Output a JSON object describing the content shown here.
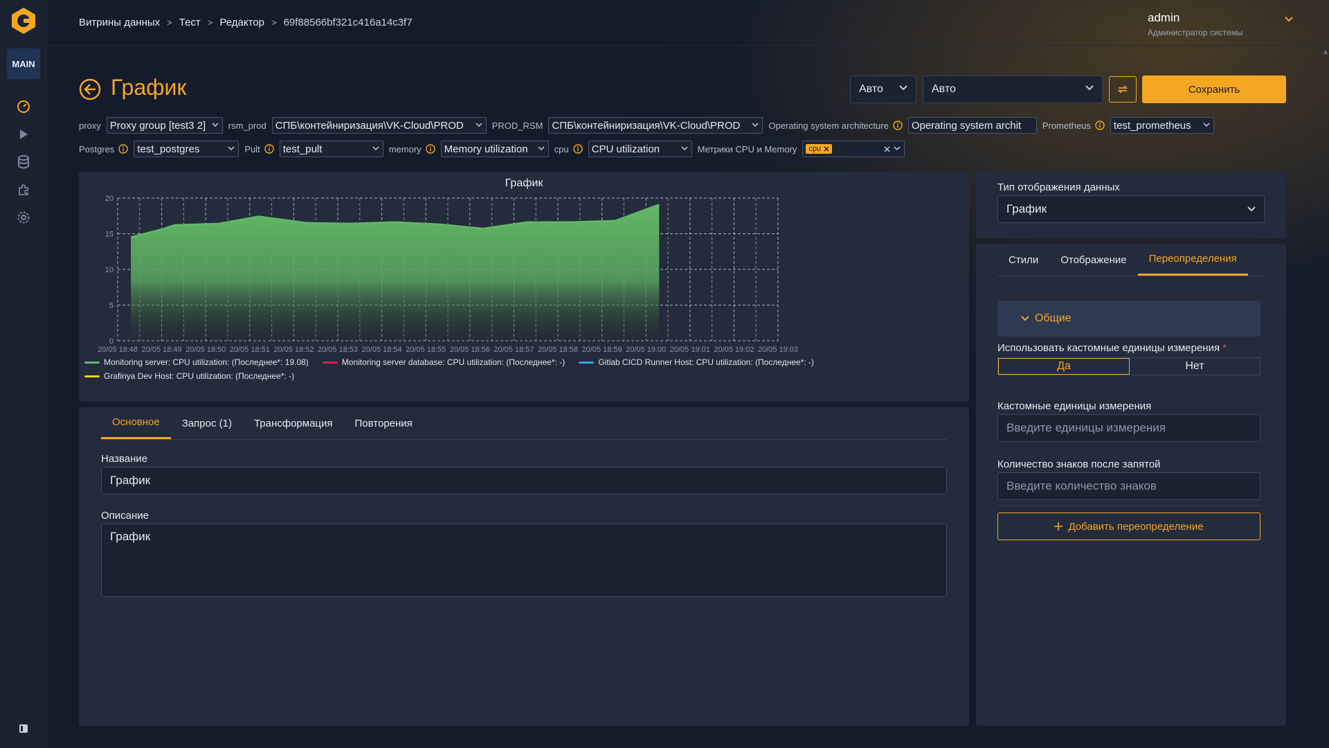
{
  "sidebar": {
    "main_label": "MAIN",
    "icons": [
      "dashboard-icon",
      "play-icon",
      "database-icon",
      "puzzle-icon",
      "gear-icon"
    ]
  },
  "breadcrumb": [
    "Витрины данных",
    "Тест",
    "Редактор",
    "69f88566bf321c416a14c3f7"
  ],
  "user": {
    "name": "admin",
    "role": "Администратор системы"
  },
  "header": {
    "title": "График",
    "select_small": "Авто",
    "select_large": "Авто",
    "save_label": "Сохранить"
  },
  "variables": {
    "row1": [
      {
        "label": "proxy",
        "value": "Proxy group [test3 2]",
        "info": false
      },
      {
        "label": "rsm_prod",
        "value": "СПБ\\контейниризация\\VK-Cloud\\PROD",
        "info": false
      },
      {
        "label": "PROD_RSM",
        "value": "СПБ\\контейниризация\\VK-Cloud\\PROD",
        "info": false
      },
      {
        "label": "Operating system architecture",
        "value": "Operating system archit",
        "info": true
      },
      {
        "label": "Prometheus",
        "value": "test_prometheus",
        "info": true
      }
    ],
    "row2": [
      {
        "label": "Postgres",
        "value": "test_postgres",
        "info": true
      },
      {
        "label": "Pult",
        "value": "test_pult",
        "info": true
      },
      {
        "label": "memory",
        "value": "Memory utilization",
        "info": true
      },
      {
        "label": "cpu",
        "value": "CPU utilization",
        "info": true
      }
    ],
    "metrics_label": "Метрики CPU и Memory",
    "metrics_chip": "cpu"
  },
  "chart_data": {
    "type": "area",
    "title": "График",
    "x": [
      "20/05 18:48",
      "20/05 18:49",
      "20/05 18:50",
      "20/05 18:51",
      "20/05 18:52",
      "20/05 18:53",
      "20/05 18:54",
      "20/05 18:55",
      "20/05 18:56",
      "20/05 18:57",
      "20/05 18:58",
      "20/05 18:59",
      "20/05 19:00",
      "20/05 19:01",
      "20/05 19:02",
      "20/05 19:03"
    ],
    "yticks": [
      0,
      5,
      10,
      15,
      20
    ],
    "ylim": [
      0,
      20
    ],
    "grid": true,
    "series": [
      {
        "name": "Monitoring server: CPU utilization: (Последнее*: 19.08)",
        "color": "#5fb865",
        "points": [
          {
            "t": 0.3,
            "v": 14.5
          },
          {
            "t": 1.0,
            "v": 15.6
          },
          {
            "t": 1.3,
            "v": 16.2
          },
          {
            "t": 2.3,
            "v": 16.4
          },
          {
            "t": 3.2,
            "v": 17.4
          },
          {
            "t": 4.3,
            "v": 16.5
          },
          {
            "t": 5.3,
            "v": 16.4
          },
          {
            "t": 6.3,
            "v": 16.6
          },
          {
            "t": 7.3,
            "v": 16.3
          },
          {
            "t": 8.3,
            "v": 15.7
          },
          {
            "t": 9.3,
            "v": 16.6
          },
          {
            "t": 10.3,
            "v": 16.6
          },
          {
            "t": 11.3,
            "v": 16.8
          },
          {
            "t": 12.3,
            "v": 19.08
          }
        ]
      },
      {
        "name": "Monitoring server database: CPU utilization: (Последнее*: -)",
        "color": "#d81b4a",
        "points": []
      },
      {
        "name": "Gitlab CICD Runner Host: CPU utilization: (Последнее*: -)",
        "color": "#2ea8e5",
        "points": []
      },
      {
        "name": "Grafinya Dev Host: CPU utilization: (Последнее*: -)",
        "color": "#e8d21d",
        "points": []
      }
    ]
  },
  "editor": {
    "tabs": [
      "Основное",
      "Запрос (1)",
      "Трансформация",
      "Повторения"
    ],
    "name_label": "Название",
    "name_value": "График",
    "desc_label": "Описание",
    "desc_value": "График"
  },
  "display_type": {
    "label": "Тип отображения данных",
    "value": "График"
  },
  "settings": {
    "tabs": [
      "Стили",
      "Отображение",
      "Переопределения"
    ],
    "section": "Общие",
    "custom_units_toggle_label": "Использовать кастомные единицы измерения",
    "required_mark": "*",
    "yes": "Да",
    "no": "Нет",
    "units_label": "Кастомные единицы измерения",
    "units_placeholder": "Введите единицы измерения",
    "decimals_label": "Количество знаков после запятой",
    "decimals_placeholder": "Введите количество знаков",
    "add_override": "Добавить переопределение"
  }
}
